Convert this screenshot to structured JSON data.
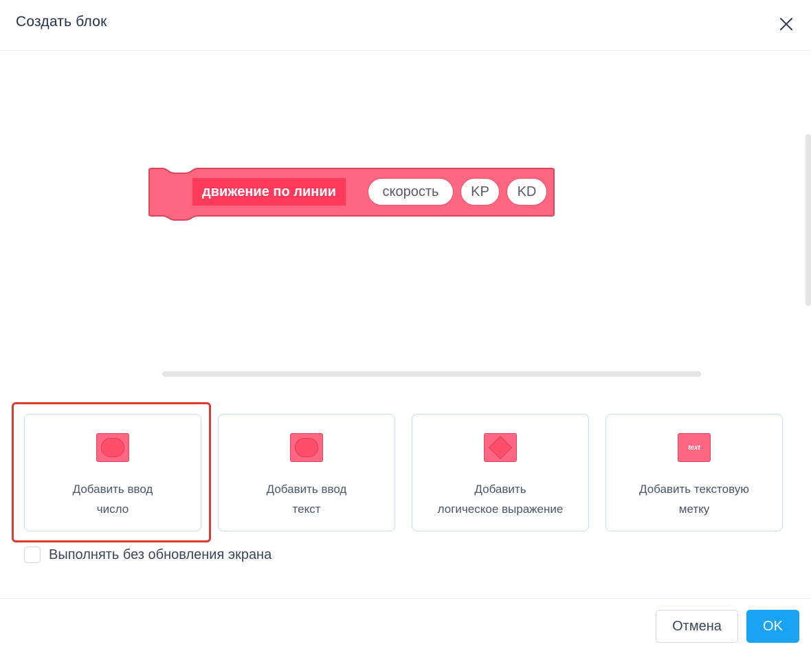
{
  "dialog": {
    "title": "Создать блок",
    "close_icon": "close-icon"
  },
  "block": {
    "label": "движение по линии",
    "inputs": [
      "скорость",
      "KP",
      "KD"
    ],
    "color": "#ff6680",
    "label_bg": "#ff3a5d"
  },
  "cards": [
    {
      "line1": "Добавить ввод",
      "line2": "число",
      "icon": "number-input-icon"
    },
    {
      "line1": "Добавить ввод",
      "line2": "текст",
      "icon": "text-input-icon"
    },
    {
      "line1": "Добавить",
      "line2": "логическое выражение",
      "icon": "boolean-input-icon"
    },
    {
      "line1": "Добавить текстовую",
      "line2": "метку",
      "icon": "text-label-icon",
      "icon_text": "text"
    }
  ],
  "checkbox": {
    "label": "Выполнять без обновления экрана",
    "checked": false
  },
  "footer": {
    "cancel_label": "Отмена",
    "ok_label": "OK"
  },
  "colors": {
    "accent": "#1aa3f2",
    "highlight": "#dd3a33",
    "block": "#ff6680"
  }
}
